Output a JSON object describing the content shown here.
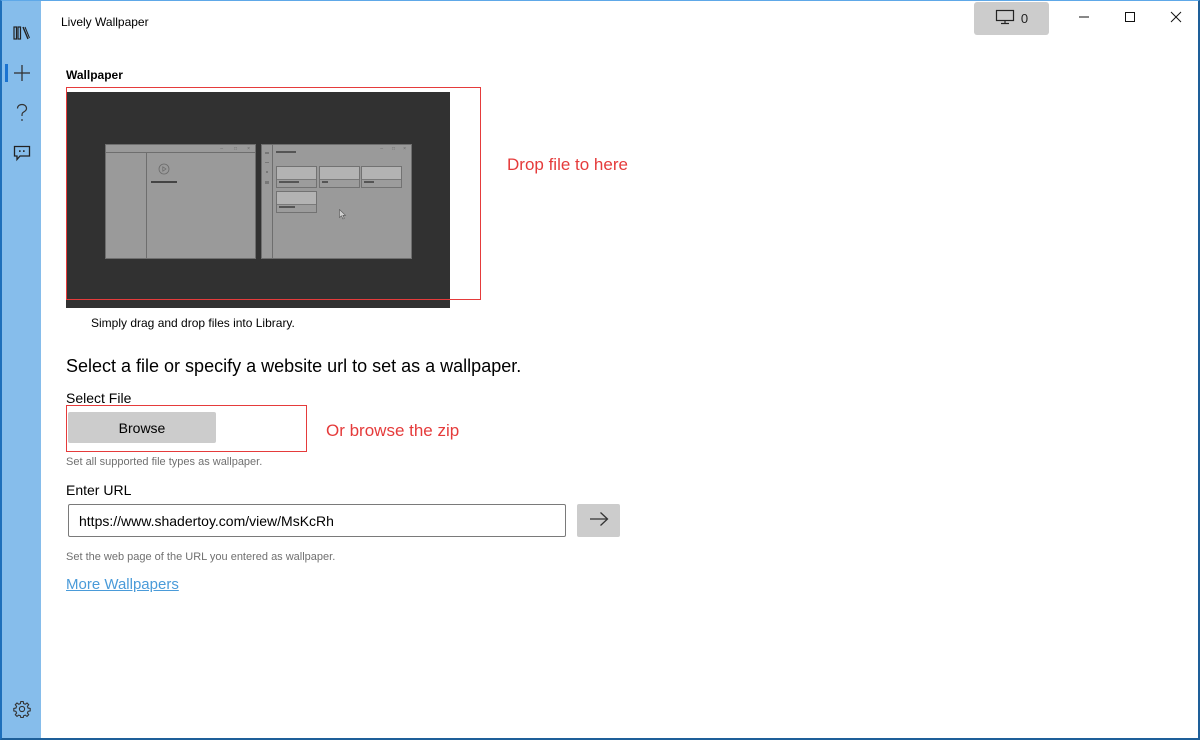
{
  "window": {
    "title": "Lively Wallpaper",
    "monitor_count": "0",
    "caption_buttons": [
      "minimize",
      "maximize",
      "close"
    ]
  },
  "sidebar": {
    "items": [
      {
        "id": "library",
        "icon": "library-icon",
        "selected": false
      },
      {
        "id": "add",
        "icon": "plus-icon",
        "selected": true
      },
      {
        "id": "help",
        "icon": "question-icon",
        "selected": false
      },
      {
        "id": "feedback",
        "icon": "feedback-icon",
        "selected": false
      }
    ],
    "footer": {
      "id": "settings",
      "icon": "gear-icon"
    }
  },
  "main": {
    "section_label": "Wallpaper",
    "preview_caption": "Simply drag and drop files into Library.",
    "drop_annotation": "Drop file to here",
    "heading": "Select a file or specify a website url to set as a wallpaper.",
    "select_file": {
      "label": "Select File",
      "button_label": "Browse",
      "annotation": "Or browse the zip",
      "hint": "Set all supported file types as wallpaper."
    },
    "url": {
      "label": "Enter URL",
      "value": "https://www.shadertoy.com/view/MsKcRh",
      "go_icon": "arrow-right-icon",
      "hint": "Set the web page of the URL you entered as wallpaper."
    },
    "more_link": "More Wallpapers"
  },
  "colors": {
    "sidebar": "#86bdeb",
    "accent": "#1a73d1",
    "annotation_red": "#e53b3b",
    "link": "#4a9bd9",
    "button_gray": "#cccccc"
  }
}
